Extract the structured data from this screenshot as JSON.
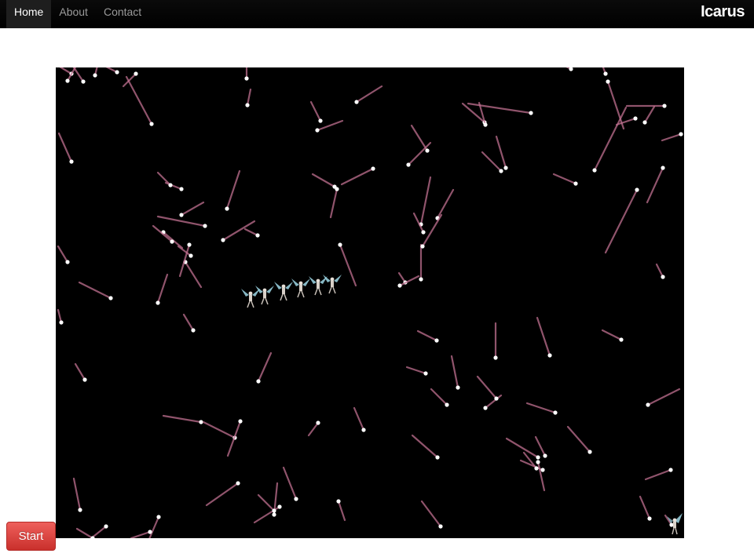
{
  "navbar": {
    "items": [
      {
        "label": "Home",
        "active": true
      },
      {
        "label": "About",
        "active": false
      },
      {
        "label": "Contact",
        "active": false
      }
    ],
    "brand": "Icarus"
  },
  "game": {
    "background_color": "#000000",
    "particle_color": "#ffffff",
    "trail_color": "#c07090",
    "sprite_color": "#9fd8e8"
  },
  "controls": {
    "start_label": "Start",
    "start_color": "#da4f49"
  }
}
